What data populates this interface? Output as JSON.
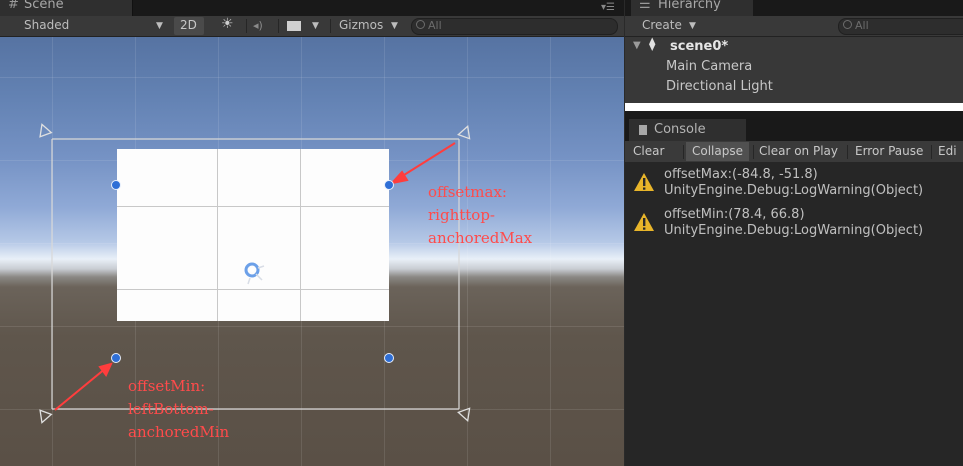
{
  "scene": {
    "tab_label": "Scene",
    "tab_icon": "hash-icon",
    "toolbar": {
      "shading_mode": "Shaded",
      "mode_2d": "2D",
      "gizmos": "Gizmos",
      "search_placeholder": "All"
    },
    "annotations": {
      "offset_max": [
        "offsetmax:",
        "righttop-",
        "anchoredMax"
      ],
      "offset_min": [
        "offsetMin:",
        "leftBottom-",
        "anchoredMin"
      ]
    },
    "accent_color": "#ff4b4b",
    "handle_color": "#2f6fd6"
  },
  "hierarchy": {
    "tab_label": "Hierarchy",
    "create_label": "Create",
    "search_placeholder": "All",
    "scene_name": "scene0*",
    "items": [
      "Main Camera",
      "Directional Light"
    ]
  },
  "console": {
    "tab_label": "Console",
    "buttons": [
      "Clear",
      "Collapse",
      "Clear on Play",
      "Error Pause",
      "Edi"
    ],
    "logs": [
      {
        "message": "offsetMax:(-84.8, -51.8)",
        "detail": "UnityEngine.Debug:LogWarning(Object)",
        "icon": "warning-icon"
      },
      {
        "message": "offsetMin:(78.4, 66.8)",
        "detail": "UnityEngine.Debug:LogWarning(Object)",
        "icon": "warning-icon"
      }
    ]
  }
}
